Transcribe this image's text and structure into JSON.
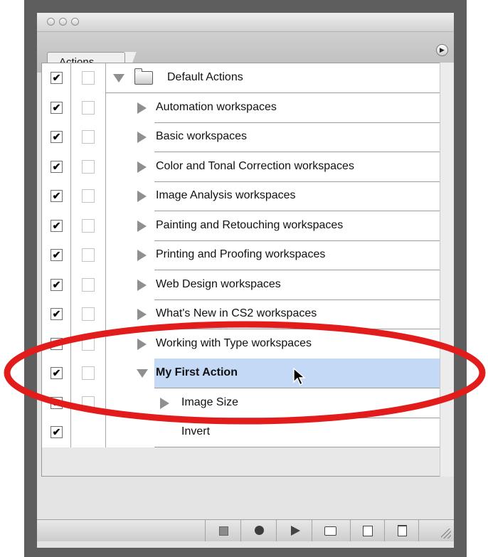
{
  "panel": {
    "tab_label": "Actions",
    "menu_icon": "flyout-menu-icon"
  },
  "rows": [
    {
      "label": "Default Actions",
      "checked": true,
      "kind": "set",
      "expanded": true
    },
    {
      "label": "Automation workspaces",
      "checked": true,
      "kind": "action",
      "expanded": false
    },
    {
      "label": "Basic workspaces",
      "checked": true,
      "kind": "action",
      "expanded": false
    },
    {
      "label": "Color and Tonal Correction workspaces",
      "checked": true,
      "kind": "action",
      "expanded": false
    },
    {
      "label": "Image Analysis workspaces",
      "checked": true,
      "kind": "action",
      "expanded": false
    },
    {
      "label": "Painting and Retouching workspaces",
      "checked": true,
      "kind": "action",
      "expanded": false
    },
    {
      "label": "Printing and Proofing workspaces",
      "checked": true,
      "kind": "action",
      "expanded": false
    },
    {
      "label": "Web Design workspaces",
      "checked": true,
      "kind": "action",
      "expanded": false
    },
    {
      "label": "What's New in CS2 workspaces",
      "checked": true,
      "kind": "action",
      "expanded": false
    },
    {
      "label": "Working with Type workspaces",
      "checked": true,
      "kind": "action",
      "expanded": false
    },
    {
      "label": "My First Action",
      "checked": true,
      "kind": "action",
      "expanded": true,
      "selected": true
    },
    {
      "label": "Image Size",
      "checked": true,
      "kind": "step",
      "expanded": false
    },
    {
      "label": "Invert",
      "checked": true,
      "kind": "step",
      "expanded": false
    }
  ],
  "bottom_bar": {
    "buttons": [
      "stop-icon",
      "record-icon",
      "play-icon",
      "new-set-icon",
      "new-action-icon",
      "trash-icon"
    ]
  },
  "colors": {
    "selection": "#c3d9f5",
    "highlight_ellipse": "#e21b1b"
  }
}
